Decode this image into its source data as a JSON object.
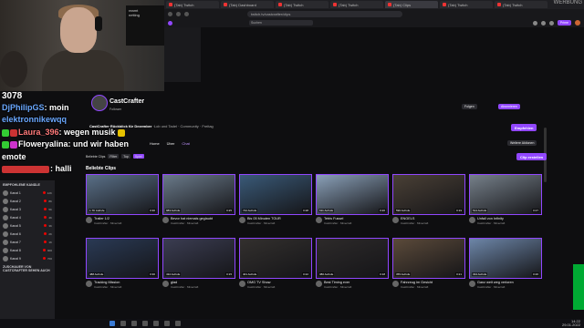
{
  "browser": {
    "tabs": [
      {
        "label": "(Tab) Twitch"
      },
      {
        "label": "(Tab) Dashboard"
      },
      {
        "label": "(Tab) Twitch"
      },
      {
        "label": "(Tab) Twitch"
      },
      {
        "label": "(Tab) Clips"
      },
      {
        "label": "(Tab) Twitch"
      },
      {
        "label": "(Tab) Twitch"
      }
    ],
    "url": "twitch.tv/castcrafter/clips",
    "ad_label": "WERBUNG"
  },
  "twitch_topbar": {
    "search_placeholder": "Suchen",
    "get_prime": "Prime"
  },
  "overlay": {
    "viewer_count": "3078",
    "monitor_text": "reamt\nnetting",
    "chat": [
      {
        "user": "DjPhilipGS",
        "message": "moin"
      },
      {
        "user": "elektronnikewqq",
        "message": ""
      },
      {
        "user": "Laura_396",
        "message": "wegen musik"
      },
      {
        "user": "Floweryalina",
        "message": "und wir haben"
      },
      {
        "user": "",
        "message": "emote"
      },
      {
        "user": "",
        "message": "halli"
      }
    ]
  },
  "sidebar": {
    "heading": "EMPFOHLENE KANÄLE",
    "heading2": "ZUSCHAUER VON CASTCRAFTER SEHEN AUCH",
    "items": [
      {
        "name": "Kanal 1",
        "viewers": "12K"
      },
      {
        "name": "Kanal 2",
        "viewers": "8K"
      },
      {
        "name": "Kanal 3",
        "viewers": "5K"
      },
      {
        "name": "Kanal 4",
        "viewers": "4K"
      },
      {
        "name": "Kanal 5",
        "viewers": "3K"
      },
      {
        "name": "Kanal 6",
        "viewers": "2K"
      },
      {
        "name": "Kanal 7",
        "viewers": "1K"
      },
      {
        "name": "Kanal 8",
        "viewers": "900"
      },
      {
        "name": "Kanal 9",
        "viewers": "700"
      }
    ]
  },
  "channel": {
    "name": "CastCrafter",
    "followers": "Follower",
    "follow_label": "Folgen",
    "subscribe_label": "Abonnieren",
    "title_prefix": "CastCrafter Rückblick für Dezember",
    "title_rest": "·Lob und Tadel · Community · Freitag",
    "tab_home": "Home",
    "tab_about": "Über",
    "tab_chat": "Chat",
    "recommend_label": "Empfehlen",
    "more_label": "Weitere Aktionen",
    "filter_label": "Beliebte Clips",
    "filter_period": "Filter",
    "filter_sort": "Top",
    "filter_lang": "Spiel",
    "create_clip": "Clip erstellen",
    "section_title": "Beliebte Clips"
  },
  "clips": [
    {
      "title": "Trailer 1/2",
      "meta": "CastCrafter · Minecraft",
      "views": "1.7K Aufrufe",
      "dur": "0:30",
      "color": "#5a7088"
    },
    {
      "title": "Bevor hat niemals geglaubt",
      "meta": "CastCrafter · Minecraft",
      "views": "983 Aufrufe",
      "dur": "0:25",
      "color": "#6a7a8a"
    },
    {
      "title": "Bis 05 Minuten TOUR",
      "meta": "CastCrafter · Minecraft",
      "views": "742 Aufrufe",
      "dur": "0:28",
      "color": "#3a5a78"
    },
    {
      "title": "Tetris Fussel",
      "meta": "CastCrafter · Minecraft",
      "views": "611 Aufrufe",
      "dur": "0:20",
      "color": "#8aa0b8"
    },
    {
      "title": "ENGELS",
      "meta": "CastCrafter · Minecraft",
      "views": "590 Aufrufe",
      "dur": "0:19",
      "color": "#4a4036"
    },
    {
      "title": "Unfall von Infinity",
      "meta": "CastCrafter · Minecraft",
      "views": "514 Aufrufe",
      "dur": "0:27",
      "color": "#76808a"
    },
    {
      "title": "Tracking Mission",
      "meta": "CastCrafter · Minecraft",
      "views": "488 Aufrufe",
      "dur": "0:30",
      "color": "#2a3a55"
    },
    {
      "title": "glad",
      "meta": "CastCrafter · Minecraft",
      "views": "432 Aufrufe",
      "dur": "0:15",
      "color": "#3b3d52"
    },
    {
      "title": "OMG TV Show",
      "meta": "CastCrafter · Minecraft",
      "views": "401 Aufrufe",
      "dur": "0:22",
      "color": "#33302e"
    },
    {
      "title": "Best Timing ever",
      "meta": "CastCrafter · Minecraft",
      "views": "380 Aufrufe",
      "dur": "0:18",
      "color": "#2d2a2a"
    },
    {
      "title": "Fahrzeug im Gesicht",
      "meta": "CastCrafter · Minecraft",
      "views": "355 Aufrufe",
      "dur": "0:21",
      "color": "#5b4a3a"
    },
    {
      "title": "Ganz weit weg verloren",
      "meta": "CastCrafter · Minecraft",
      "views": "334 Aufrufe",
      "dur": "0:26",
      "color": "#6d86a8"
    }
  ],
  "taskbar": {
    "time": "14:22",
    "date": "29.01.2022"
  }
}
